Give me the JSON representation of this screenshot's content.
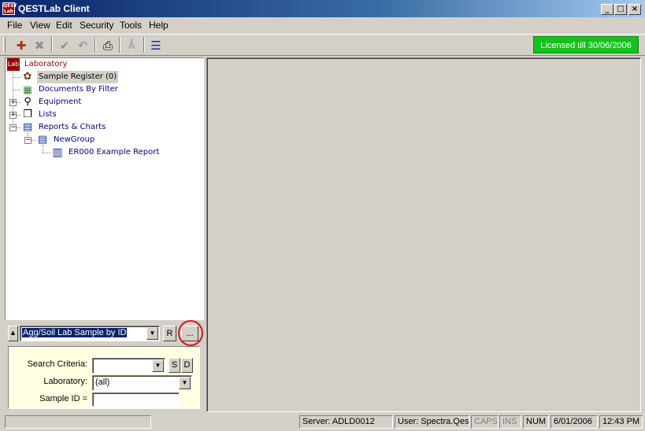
{
  "window": {
    "title": "QESTLab Client",
    "icon_text": "QEST Lab",
    "min": "_",
    "max": "□",
    "close": "×"
  },
  "menu": [
    "File",
    "View",
    "Edit",
    "Security",
    "Tools",
    "Help"
  ],
  "toolbar": {
    "icons": [
      "new-record-icon",
      "delete-icon",
      "check-icon",
      "undo-icon",
      "print-icon",
      "spell-check-icon",
      "tree-view-icon"
    ],
    "license": "Licensed till 30/06/2006"
  },
  "tree": {
    "root": {
      "label": "Laboratory",
      "icon": "Lab"
    },
    "items": [
      {
        "label": "Sample Register (0)",
        "icon": "sample-register-icon"
      },
      {
        "label": "Documents By Filter",
        "icon": "filter-icon"
      },
      {
        "label": "Equipment",
        "icon": "equipment-icon"
      },
      {
        "label": "Lists",
        "icon": "lists-icon"
      },
      {
        "label": "Reports & Charts",
        "icon": "reports-icon"
      },
      {
        "label": "NewGroup",
        "icon": "group-icon"
      },
      {
        "label": "ER000 Example Report",
        "icon": "report-icon"
      }
    ]
  },
  "search": {
    "selected": "Agg/Soil Lab Sample by ID",
    "r_button": "R",
    "more_button": "...",
    "criteria_label": "Search Criteria:",
    "criteria_value": "",
    "s_button": "S",
    "d_button": "D",
    "laboratory_label": "Laboratory:",
    "laboratory_value": "(all)",
    "sample_label": "Sample ID =",
    "sample_value": ""
  },
  "status": {
    "server": "Server: ADLD0012",
    "user": "User: Spectra.Qest",
    "caps": "CAPS",
    "ins": "INS",
    "num": "NUM",
    "date": "6/01/2006",
    "time": "12:43 PM"
  },
  "colors": {
    "license_bg": "#15c11c",
    "selection": "#0a246a",
    "highlight_circle": "#e01010"
  }
}
